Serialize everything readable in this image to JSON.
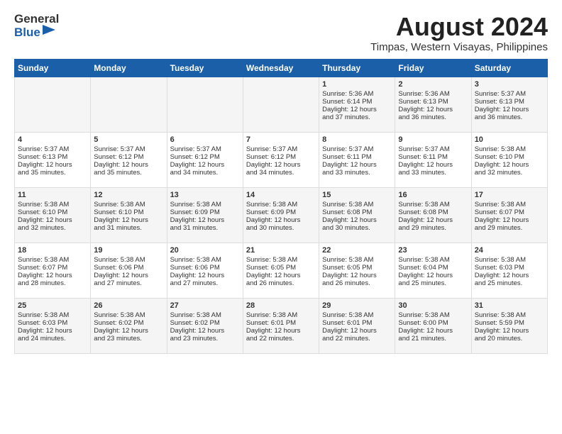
{
  "header": {
    "logo_general": "General",
    "logo_blue": "Blue",
    "main_title": "August 2024",
    "subtitle": "Timpas, Western Visayas, Philippines"
  },
  "calendar": {
    "days_of_week": [
      "Sunday",
      "Monday",
      "Tuesday",
      "Wednesday",
      "Thursday",
      "Friday",
      "Saturday"
    ],
    "weeks": [
      [
        {
          "day": "",
          "content": ""
        },
        {
          "day": "",
          "content": ""
        },
        {
          "day": "",
          "content": ""
        },
        {
          "day": "",
          "content": ""
        },
        {
          "day": "1",
          "content": "Sunrise: 5:36 AM\nSunset: 6:14 PM\nDaylight: 12 hours\nand 37 minutes."
        },
        {
          "day": "2",
          "content": "Sunrise: 5:36 AM\nSunset: 6:13 PM\nDaylight: 12 hours\nand 36 minutes."
        },
        {
          "day": "3",
          "content": "Sunrise: 5:37 AM\nSunset: 6:13 PM\nDaylight: 12 hours\nand 36 minutes."
        }
      ],
      [
        {
          "day": "4",
          "content": "Sunrise: 5:37 AM\nSunset: 6:13 PM\nDaylight: 12 hours\nand 35 minutes."
        },
        {
          "day": "5",
          "content": "Sunrise: 5:37 AM\nSunset: 6:12 PM\nDaylight: 12 hours\nand 35 minutes."
        },
        {
          "day": "6",
          "content": "Sunrise: 5:37 AM\nSunset: 6:12 PM\nDaylight: 12 hours\nand 34 minutes."
        },
        {
          "day": "7",
          "content": "Sunrise: 5:37 AM\nSunset: 6:12 PM\nDaylight: 12 hours\nand 34 minutes."
        },
        {
          "day": "8",
          "content": "Sunrise: 5:37 AM\nSunset: 6:11 PM\nDaylight: 12 hours\nand 33 minutes."
        },
        {
          "day": "9",
          "content": "Sunrise: 5:37 AM\nSunset: 6:11 PM\nDaylight: 12 hours\nand 33 minutes."
        },
        {
          "day": "10",
          "content": "Sunrise: 5:38 AM\nSunset: 6:10 PM\nDaylight: 12 hours\nand 32 minutes."
        }
      ],
      [
        {
          "day": "11",
          "content": "Sunrise: 5:38 AM\nSunset: 6:10 PM\nDaylight: 12 hours\nand 32 minutes."
        },
        {
          "day": "12",
          "content": "Sunrise: 5:38 AM\nSunset: 6:10 PM\nDaylight: 12 hours\nand 31 minutes."
        },
        {
          "day": "13",
          "content": "Sunrise: 5:38 AM\nSunset: 6:09 PM\nDaylight: 12 hours\nand 31 minutes."
        },
        {
          "day": "14",
          "content": "Sunrise: 5:38 AM\nSunset: 6:09 PM\nDaylight: 12 hours\nand 30 minutes."
        },
        {
          "day": "15",
          "content": "Sunrise: 5:38 AM\nSunset: 6:08 PM\nDaylight: 12 hours\nand 30 minutes."
        },
        {
          "day": "16",
          "content": "Sunrise: 5:38 AM\nSunset: 6:08 PM\nDaylight: 12 hours\nand 29 minutes."
        },
        {
          "day": "17",
          "content": "Sunrise: 5:38 AM\nSunset: 6:07 PM\nDaylight: 12 hours\nand 29 minutes."
        }
      ],
      [
        {
          "day": "18",
          "content": "Sunrise: 5:38 AM\nSunset: 6:07 PM\nDaylight: 12 hours\nand 28 minutes."
        },
        {
          "day": "19",
          "content": "Sunrise: 5:38 AM\nSunset: 6:06 PM\nDaylight: 12 hours\nand 27 minutes."
        },
        {
          "day": "20",
          "content": "Sunrise: 5:38 AM\nSunset: 6:06 PM\nDaylight: 12 hours\nand 27 minutes."
        },
        {
          "day": "21",
          "content": "Sunrise: 5:38 AM\nSunset: 6:05 PM\nDaylight: 12 hours\nand 26 minutes."
        },
        {
          "day": "22",
          "content": "Sunrise: 5:38 AM\nSunset: 6:05 PM\nDaylight: 12 hours\nand 26 minutes."
        },
        {
          "day": "23",
          "content": "Sunrise: 5:38 AM\nSunset: 6:04 PM\nDaylight: 12 hours\nand 25 minutes."
        },
        {
          "day": "24",
          "content": "Sunrise: 5:38 AM\nSunset: 6:03 PM\nDaylight: 12 hours\nand 25 minutes."
        }
      ],
      [
        {
          "day": "25",
          "content": "Sunrise: 5:38 AM\nSunset: 6:03 PM\nDaylight: 12 hours\nand 24 minutes."
        },
        {
          "day": "26",
          "content": "Sunrise: 5:38 AM\nSunset: 6:02 PM\nDaylight: 12 hours\nand 23 minutes."
        },
        {
          "day": "27",
          "content": "Sunrise: 5:38 AM\nSunset: 6:02 PM\nDaylight: 12 hours\nand 23 minutes."
        },
        {
          "day": "28",
          "content": "Sunrise: 5:38 AM\nSunset: 6:01 PM\nDaylight: 12 hours\nand 22 minutes."
        },
        {
          "day": "29",
          "content": "Sunrise: 5:38 AM\nSunset: 6:01 PM\nDaylight: 12 hours\nand 22 minutes."
        },
        {
          "day": "30",
          "content": "Sunrise: 5:38 AM\nSunset: 6:00 PM\nDaylight: 12 hours\nand 21 minutes."
        },
        {
          "day": "31",
          "content": "Sunrise: 5:38 AM\nSunset: 5:59 PM\nDaylight: 12 hours\nand 20 minutes."
        }
      ]
    ]
  }
}
